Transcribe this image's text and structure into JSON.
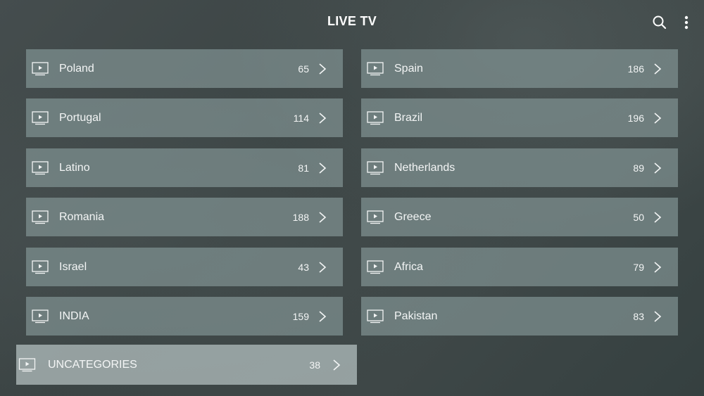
{
  "header": {
    "title": "LIVE TV",
    "icons": [
      "search-icon",
      "more-vert-icon"
    ]
  },
  "categories": [
    {
      "name": "Poland",
      "count": "65"
    },
    {
      "name": "Spain",
      "count": "186"
    },
    {
      "name": "Portugal",
      "count": "114"
    },
    {
      "name": "Brazil",
      "count": "196"
    },
    {
      "name": "Latino",
      "count": "81"
    },
    {
      "name": "Netherlands",
      "count": "89"
    },
    {
      "name": "Romania",
      "count": "188"
    },
    {
      "name": "Greece",
      "count": "50"
    },
    {
      "name": "Israel",
      "count": "43"
    },
    {
      "name": "Africa",
      "count": "79"
    },
    {
      "name": "INDIA",
      "count": "159"
    },
    {
      "name": "Pakistan",
      "count": "83"
    }
  ],
  "focused": {
    "name": "UNCATEGORIES",
    "count": "38"
  }
}
